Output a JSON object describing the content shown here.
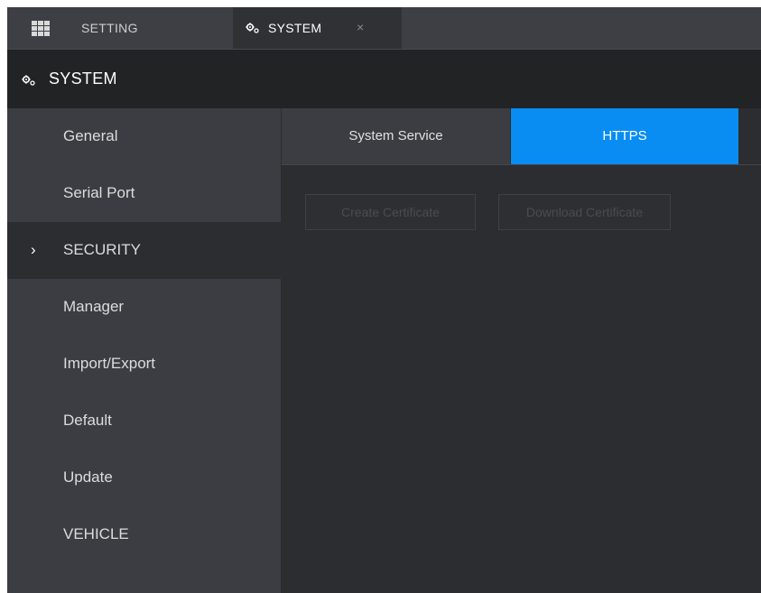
{
  "tabs": {
    "setting_label": "SETTING",
    "system_label": "SYSTEM",
    "close_glyph": "×"
  },
  "header": {
    "title": "SYSTEM"
  },
  "sidebar": {
    "items": [
      {
        "label": "General"
      },
      {
        "label": "Serial Port"
      },
      {
        "label": "SECURITY"
      },
      {
        "label": "Manager"
      },
      {
        "label": "Import/Export"
      },
      {
        "label": "Default"
      },
      {
        "label": "Update"
      },
      {
        "label": "VEHICLE"
      }
    ],
    "active_chevron": "›"
  },
  "subtabs": {
    "system_service": "System Service",
    "https": "HTTPS"
  },
  "actions": {
    "create_certificate": "Create Certificate",
    "download_certificate": "Download Certificate"
  },
  "colors": {
    "accent": "#0a8df2",
    "background": "#2b2d30",
    "sidebar": "#3b3d42"
  },
  "icons": {
    "menu": "grid-icon",
    "system": "gear-icon",
    "close": "close-icon",
    "active_marker": "chevron-right-icon"
  }
}
